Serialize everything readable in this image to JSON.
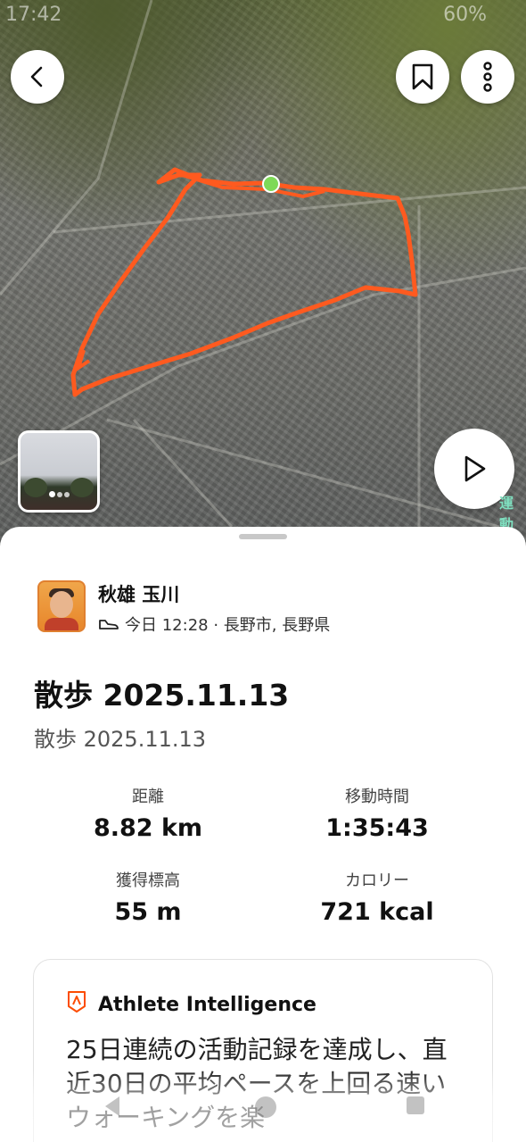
{
  "status_bar": {
    "time": "17:42",
    "battery": "60%"
  },
  "map": {
    "route_color": "#ff5a1f",
    "start_marker_color": "#7ed957",
    "label_fragment": "運動",
    "buttons": {
      "back_icon": "chevron-left-icon",
      "bookmark_icon": "bookmark-icon",
      "more_icon": "more-vertical-icon",
      "play_icon": "play-icon"
    }
  },
  "athlete": {
    "name": "秋雄 玉川",
    "meta": "今日 12:28 · 長野市, 長野県",
    "activity_icon": "shoe-icon"
  },
  "activity": {
    "title": "散歩 2025.11.13",
    "subtitle": "散歩 2025.11.13"
  },
  "stats": [
    {
      "label": "距離",
      "value": "8.82 km"
    },
    {
      "label": "移動時間",
      "value": "1:35:43"
    },
    {
      "label": "獲得標高",
      "value": "55 m"
    },
    {
      "label": "カロリー",
      "value": "721 kcal"
    }
  ],
  "ai_card": {
    "title": "Athlete Intelligence",
    "text": "25日連続の活動記録を達成し、直近30日の平均ペースを上回る速いウォーキングを楽",
    "accent": "#fc4c02"
  }
}
